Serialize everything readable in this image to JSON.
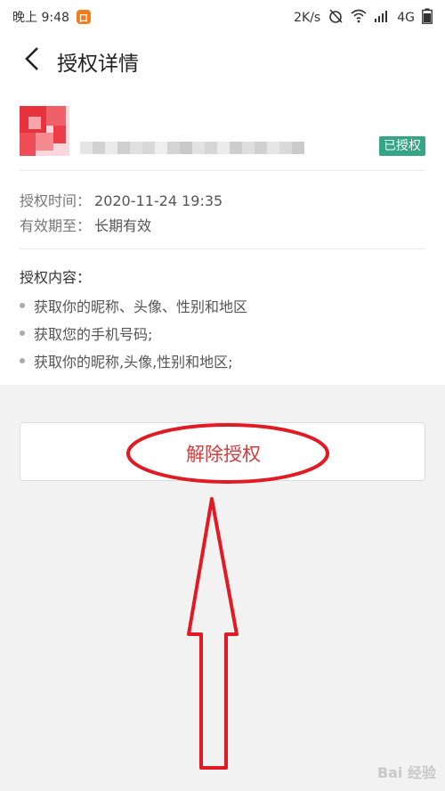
{
  "status_bar": {
    "time": "晚上 9:48",
    "app_badge": "口",
    "network_speed": "2K/s",
    "network_type": "4G"
  },
  "header": {
    "title": "授权详情"
  },
  "app": {
    "status_badge": "已授权"
  },
  "details": {
    "auth_time_label": "授权时间：",
    "auth_time_value": "2020-11-24 19:35",
    "valid_until_label": "有效期至：",
    "valid_until_value": "长期有效"
  },
  "permissions": {
    "title": "授权内容：",
    "items": [
      "获取你的昵称、头像、性别和地区",
      "获取您的手机号码;",
      "获取你的昵称,头像,性别和地区;"
    ]
  },
  "actions": {
    "revoke_label": "解除授权"
  },
  "colors": {
    "accent_green": "#36a585",
    "danger_red": "#d63b3b",
    "annotation_red": "#e01b24"
  },
  "watermark": "Bai 经验"
}
